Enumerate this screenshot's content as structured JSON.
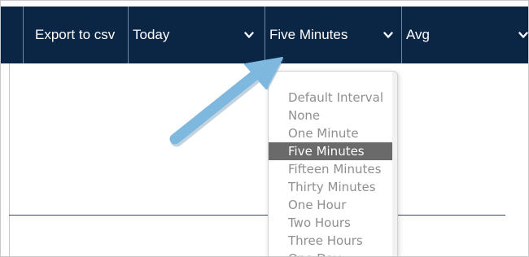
{
  "toolbar": {
    "export_label": "Export to csv",
    "range_select": {
      "value": "Today"
    },
    "interval_select": {
      "value": "Five Minutes"
    },
    "aggregate_select": {
      "value": "Avg"
    }
  },
  "interval_dropdown": {
    "options": [
      "Default Interval",
      "None",
      "One Minute",
      "Five Minutes",
      "Fifteen Minutes",
      "Thirty Minutes",
      "One Hour",
      "Two Hours",
      "Three Hours",
      "One Day"
    ],
    "selected": "Five Minutes"
  },
  "colors": {
    "toolbar_bg": "#0b2545",
    "selected_option_bg": "#6a6a6a",
    "annotation_arrow": "#7fb8df"
  },
  "icons": [
    "chevron-down-icon",
    "annotation-arrow"
  ]
}
